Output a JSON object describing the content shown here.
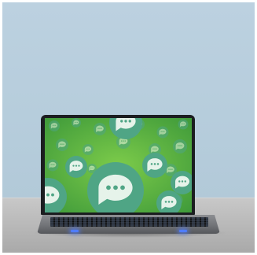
{
  "scene": {
    "description_free": true,
    "colors": {
      "wall": "#b5ccdb",
      "desk": "#bdbdbd",
      "screen_green": "#5db63d",
      "bubble_teal": "#4fa585",
      "bubble_light": "#dff0e6"
    },
    "icons": [
      "chat-bubble-icon"
    ]
  }
}
